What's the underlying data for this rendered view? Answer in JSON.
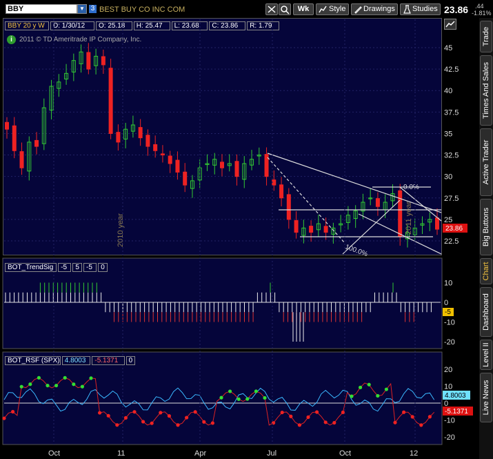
{
  "toolbar": {
    "symbol": "BBY",
    "link_number": "3",
    "company": "BEST BUY CO INC COM",
    "timeframe": "Wk",
    "style": "Style",
    "drawings": "Drawings",
    "studies": "Studies",
    "price": "23.86",
    "change": ".44",
    "change_pct": "-1.81%"
  },
  "main_chart": {
    "header": [
      "BBY 20 y W",
      "D: 1/30/12",
      "O: 25.18",
      "H: 25.47",
      "L: 23.68",
      "C: 23.86",
      "R: 1.79"
    ],
    "copyright": "2011 © TD Ameritrade IP Company, Inc.",
    "y_ticks": [
      "45",
      "42.5",
      "40",
      "37.5",
      "35",
      "32.5",
      "30",
      "27.5",
      "25",
      "22.5"
    ],
    "last_price_tag": "23.86",
    "year_label_1": "2010 year",
    "year_label_2": "2011 year",
    "fib_top": "0.0%",
    "fib_bottom": "100.0%",
    "colors": {
      "up": "#33cc33",
      "down": "#ee2222",
      "bg": "#05053a"
    }
  },
  "trend_panel": {
    "header": [
      "BOT_TrendSig",
      "-5",
      "5",
      "-5",
      "0"
    ],
    "y_ticks": [
      "10",
      "0",
      "-10",
      "-20"
    ],
    "value_tag": "-5"
  },
  "rsf_panel": {
    "header": [
      "BOT_RSF (SPX)",
      "4.8003",
      "-5.1371",
      "0"
    ],
    "y_ticks": [
      "20",
      "10",
      "0",
      "-10",
      "-20"
    ],
    "tag_a": "4.8003",
    "tag_b": "-5.1371"
  },
  "x_axis": [
    "Oct",
    "11",
    "Apr",
    "Jul",
    "Oct",
    "12"
  ],
  "right_tabs": [
    "Trade",
    "Times And Sales",
    "Active Trader",
    "Big Buttons",
    "Chart",
    "Dashboard",
    "Level II",
    "Live News"
  ],
  "chart_data": {
    "type": "candlestick",
    "weekly_closes": [
      35.5,
      33.0,
      31.0,
      34.0,
      33.5,
      38.0,
      40.5,
      41.0,
      42.0,
      43.5,
      44.5,
      42.5,
      44.0,
      43.0,
      35.0,
      34.0,
      35.5,
      36.0,
      34.5,
      33.5,
      33.0,
      32.5,
      31.5,
      30.5,
      29.0,
      29.5,
      31.0,
      31.5,
      32.0,
      31.0,
      31.5,
      30.0,
      31.5,
      32.0,
      32.5,
      30.0,
      29.0,
      27.5,
      25.0,
      23.5,
      24.0,
      23.5,
      24.5,
      23.5,
      24.0,
      24.5,
      25.5,
      26.0,
      27.0,
      27.5,
      26.5,
      27.0,
      28.0,
      23.0,
      23.5,
      24.0,
      24.5,
      25.0,
      23.86
    ],
    "last": {
      "date": "1/30/12",
      "open": 25.18,
      "high": 25.47,
      "low": 23.68,
      "close": 23.86
    }
  }
}
